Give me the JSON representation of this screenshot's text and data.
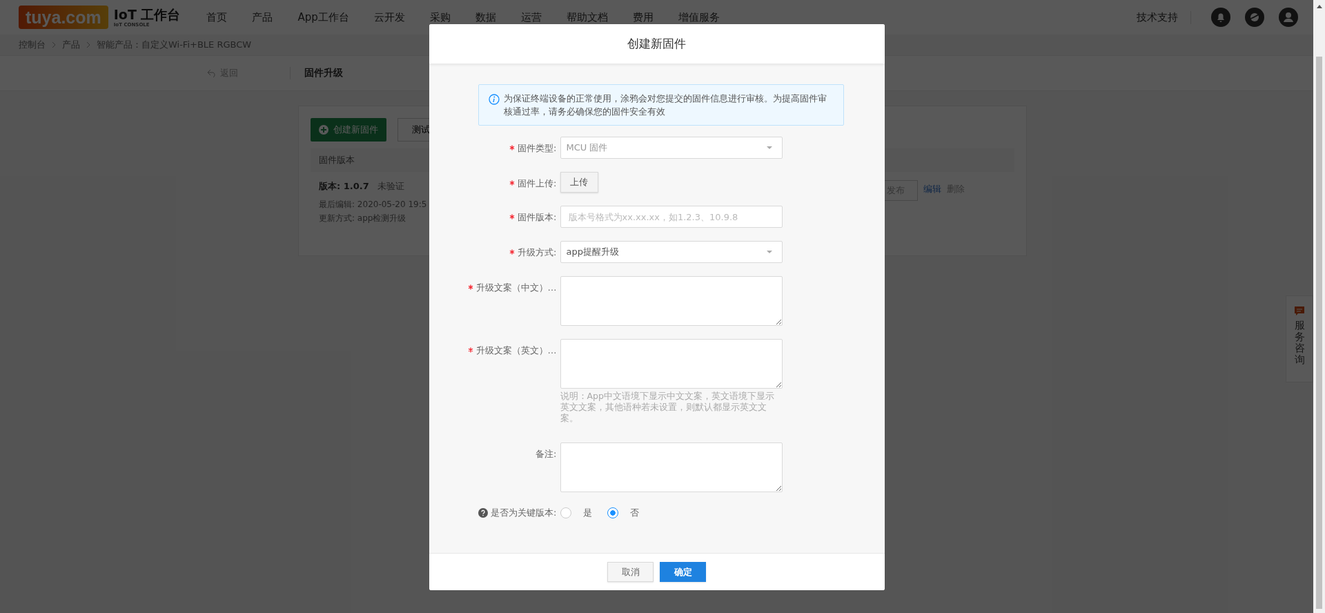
{
  "header": {
    "logo": "tuya.com",
    "brand_title": "IoT 工作台",
    "brand_subtitle": "IoT CONSOLE",
    "nav": [
      "首页",
      "产品",
      "App工作台",
      "云开发",
      "采购",
      "数据",
      "运营",
      "帮助文档",
      "费用",
      "增值服务"
    ],
    "support": "技术支持"
  },
  "breadcrumb": [
    "控制台",
    "产品",
    "智能产品：自定义Wi-Fi+BLE RGBCW"
  ],
  "subheader": {
    "back": "返回",
    "title": "固件升级"
  },
  "firmware_panel": {
    "create_button": "创建新固件",
    "test_button": "测试",
    "table_header": "固件版本",
    "row": {
      "version": "版本: 1.0.7",
      "status": "未验证",
      "edited": "最后编辑: 2020-05-20 19:5",
      "update": "更新方式: app检测升级"
    },
    "actions": [
      {
        "label": "发布",
        "kind": "button"
      },
      {
        "label": "编辑",
        "kind": "link"
      },
      {
        "label": "删除",
        "kind": "disabled"
      }
    ]
  },
  "side_tab": "服务咨询",
  "modal": {
    "title": "创建新固件",
    "notice": "为保证终端设备的正常使用，涂鸦会对您提交的固件信息进行审核。为提高固件审核通过率，请务必确保您的固件安全有效",
    "fields": [
      {
        "label": "固件类型:",
        "required": true,
        "kind": "select",
        "value": "MCU 固件",
        "muted": true
      },
      {
        "label": "固件上传:",
        "required": true,
        "kind": "upload",
        "value": "上传"
      },
      {
        "label": "固件版本:",
        "required": true,
        "kind": "input",
        "placeholder": "版本号格式为xx.xx.xx，如1.2.3、10.9.8"
      },
      {
        "label": "升级方式:",
        "required": true,
        "kind": "select",
        "value": "app提醒升级",
        "muted": false
      },
      {
        "label": "升级文案（中文）…",
        "required": true,
        "kind": "textarea"
      },
      {
        "label": "升级文案（英文）…",
        "required": true,
        "kind": "textarea",
        "hint": "说明：App中文语境下显示中文文案，英文语境下显示英文文案，其他语种若未设置，则默认都显示英文文案。"
      },
      {
        "label": "备注:",
        "required": false,
        "kind": "textarea"
      },
      {
        "label": "是否为关键版本:",
        "required": false,
        "kind": "radio",
        "options": [
          {
            "label": "是",
            "selected": false
          },
          {
            "label": "否",
            "selected": true
          }
        ]
      }
    ],
    "buttons": [
      {
        "label": "取消",
        "kind": "default"
      },
      {
        "label": "确定",
        "kind": "primary"
      }
    ]
  }
}
